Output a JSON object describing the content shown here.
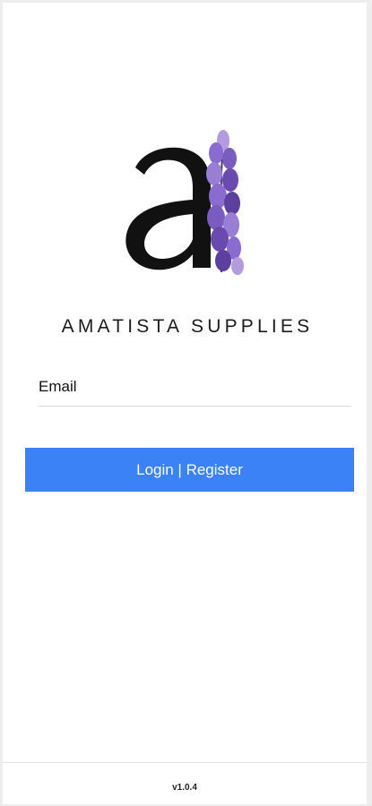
{
  "brand": {
    "logo_icon": "amatista-letter-a-with-lavender-icon",
    "name": "AMATISTA SUPPLIES"
  },
  "form": {
    "email_label": "Email",
    "email_value": "",
    "login_button_label": "Login | Register"
  },
  "footer": {
    "version": "v1.0.4"
  },
  "colors": {
    "accent": "#3b82f6",
    "lavender": "#8a6bcf"
  }
}
